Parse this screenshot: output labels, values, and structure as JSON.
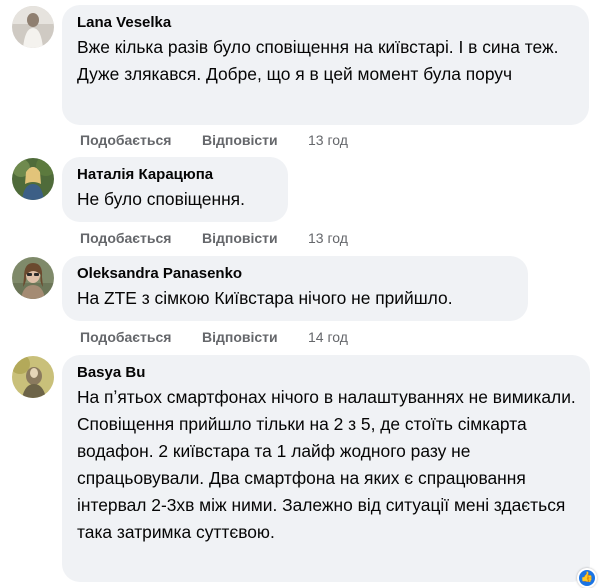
{
  "comments": [
    {
      "author": "Lana Veselka",
      "text": "Вже кілька разів було сповіщення на київстарі. І в сина теж. Дуже злякався. Добре, що я в цей момент була поруч",
      "like_label": "Подобається",
      "reply_label": "Відповісти",
      "time": "13 год"
    },
    {
      "author": "Наталія Карацюпа",
      "text": "Не було сповіщення.",
      "like_label": "Подобається",
      "reply_label": "Відповісти",
      "time": "13 год"
    },
    {
      "author": "Oleksandra Panasenko",
      "text": "На ZTE з сімкою Київстара нічого не прийшло.",
      "like_label": "Подобається",
      "reply_label": "Відповісти",
      "time": "14 год"
    },
    {
      "author": "Basya Bu",
      "text": "На пʼятьох смартфонах нічого в налаштуваннях не вимикали. Сповіщення прийшло тільки на 2 з 5, де стоїть сімкарта водафон. 2 київстара та 1 лайф жодного разу не спрацьовували. Два смартфона на яких є спрацювання інтервал 2-3хв між ними. Залежно від ситуації мені здається така затримка суттєвою."
    }
  ],
  "reaction_icon": "like-icon",
  "colors": {
    "bubble": "#f0f2f5",
    "text": "#050505",
    "meta": "#65676b",
    "reaction": "#1b74e4"
  }
}
